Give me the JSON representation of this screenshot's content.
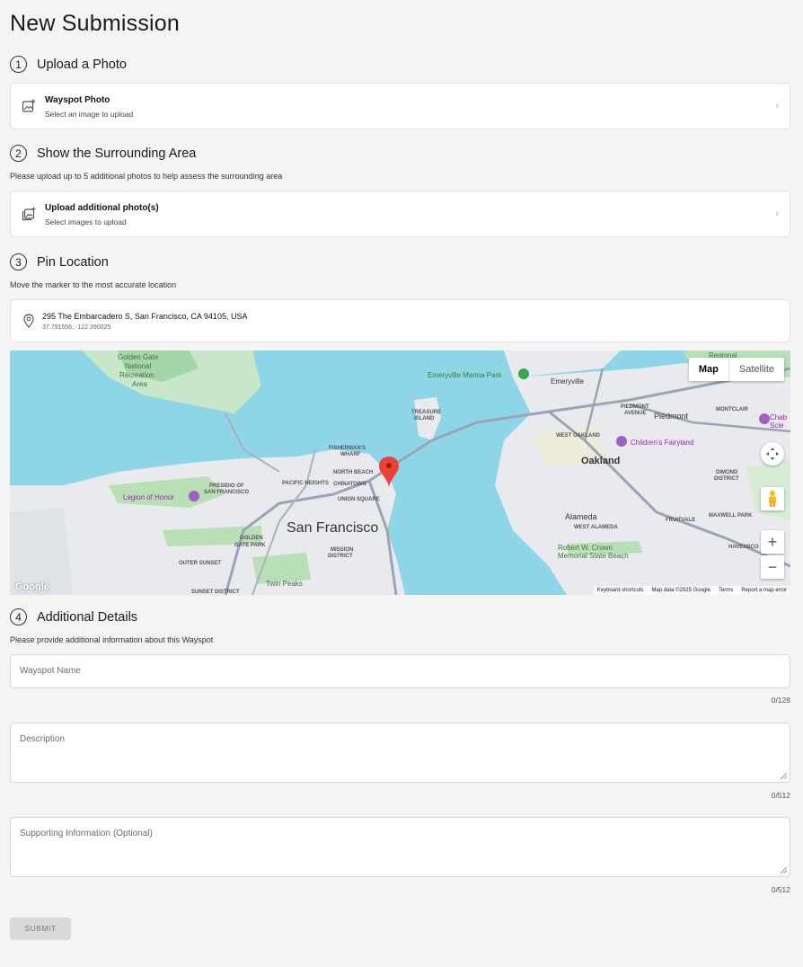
{
  "page_title": "New Submission",
  "sections": {
    "upload": {
      "number": "1",
      "title": "Upload a Photo",
      "card_title": "Wayspot Photo",
      "card_subtitle": "Select an image to upload"
    },
    "surrounding": {
      "number": "2",
      "title": "Show the Surrounding Area",
      "description": "Please upload up to 5 additional photos to help assess the surrounding area",
      "card_title": "Upload additional photo(s)",
      "card_subtitle": "Select images to upload"
    },
    "pin": {
      "number": "3",
      "title": "Pin Location",
      "description": "Move the marker to the most accurate location",
      "address": "295 The Embarcadero S, San Francisco, CA 94105, USA",
      "coordinates": "37.791556, -122.390025"
    },
    "details": {
      "number": "4",
      "title": "Additional Details",
      "description": "Please provide additional information about this Wayspot"
    }
  },
  "map": {
    "toggle_map": "Map",
    "toggle_satellite": "Satellite",
    "zoom_in": "+",
    "zoom_out": "−",
    "logo": "Google",
    "footer": {
      "shortcuts": "Keyboard shortcuts",
      "data": "Map data ©2025 Google",
      "terms": "Terms",
      "report": "Report a map error"
    },
    "labels": {
      "sf": "San Francisco",
      "oakland": "Oakland",
      "alameda": "Alameda",
      "piedmont": "Piedmont",
      "emeryville": "Emeryville",
      "emeryville_park": "Emeryville Marina Park",
      "treasure": "TREASURE",
      "island": "ISLAND",
      "fishermans": "FISHERMAN'S",
      "wharf": "WHARF",
      "north_beach": "NORTH BEACH",
      "chinatown": "CHINATOWN",
      "union_square": "UNION SQUARE",
      "pacific_heights": "PACIFIC HEIGHTS",
      "presidio_of": "PRESIDIO OF",
      "presidio_sf": "SAN FRANCISCO",
      "legion": "Legion of Honor",
      "golden": "GOLDEN",
      "gate_park": "GATE PARK",
      "outer_sunset": "OUTER SUNSET",
      "sunset_district": "SUNSET DISTRICT",
      "twin_peaks": "Twin Peaks",
      "mission": "MISSION",
      "district": "DISTRICT",
      "ggnra1": "Golden Gate",
      "ggnra2": "National",
      "ggnra3": "Recreation",
      "ggnra4": "Area",
      "west_oakland": "WEST OAKLAND",
      "childrens": "Children's Fairyland",
      "piedmont_ave1": "PIEDMONT",
      "piedmont_ave2": "AVENUE",
      "montclair": "MONTCLAIR",
      "dimond1": "DIMOND",
      "dimond2": "DISTRICT",
      "west_alameda": "WEST ALAMEDA",
      "crown1": "Robert W. Crown",
      "crown2": "Memorial State Beach",
      "fruitvale": "FRUITVALE",
      "maxwell": "MAXWELL PARK",
      "havenscourt": "HAVENSCO",
      "regional": "Regional",
      "cabot1": "Chab",
      "cabot2": "Scie"
    }
  },
  "form": {
    "name_placeholder": "Wayspot Name",
    "name_counter": "0/128",
    "description_placeholder": "Description",
    "description_counter": "0/512",
    "supporting_placeholder": "Supporting Information (Optional)",
    "supporting_counter": "0/512",
    "submit_label": "SUBMIT"
  }
}
